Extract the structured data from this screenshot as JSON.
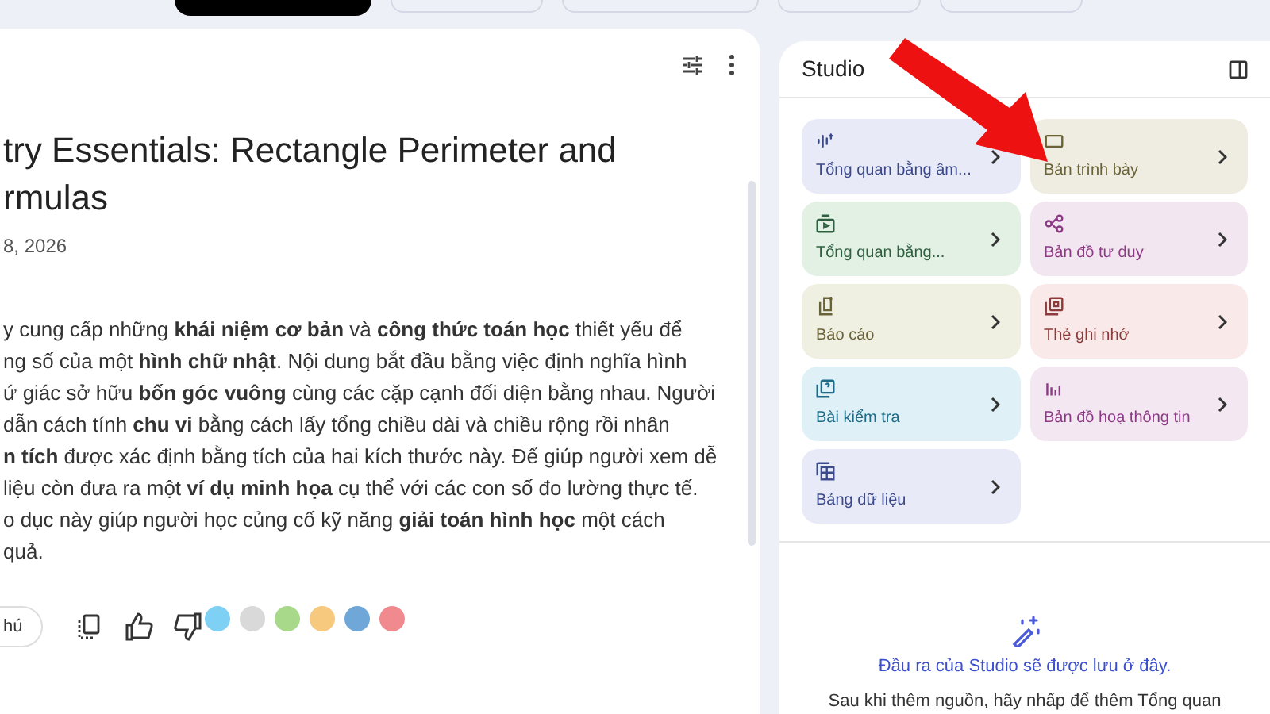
{
  "note": {
    "title_lines": [
      "try Essentials: Rectangle Perimeter and",
      "rmulas"
    ],
    "date": "8, 2026",
    "body_lines": [
      "y cung cấp những **khái niệm cơ bản** và **công thức toán học** thiết yếu để",
      "ng số của một **hình chữ nhật**. Nội dung bắt đầu bằng việc định nghĩa hình",
      "ứ giác sở hữu **bốn góc vuông** cùng các cặp cạnh đối diện bằng nhau. Người",
      "dẫn cách tính **chu vi** bằng cách lấy tổng chiều dài và chiều rộng rồi nhân",
      "**n tích** được xác định bằng tích của hai kích thước này. Để giúp người xem dễ",
      "liệu còn đưa ra một **ví dụ minh họa** cụ thể với các con số đo lường thực tế.",
      "o dục này giúp người học củng cố kỹ năng **giải toán hình học** một cách",
      "quả."
    ],
    "save_button": "hú",
    "color_dots": [
      {
        "color": "#7fd0f5"
      },
      {
        "color": "#d9d9d9"
      },
      {
        "color": "#a8d88a"
      },
      {
        "color": "#f7c97e"
      },
      {
        "color": "#6fa8d8"
      },
      {
        "color": "#f08a8e"
      }
    ]
  },
  "studio": {
    "title": "Studio",
    "cards": [
      {
        "label": "Tổng quan bằng âm...",
        "kind": "audio",
        "color": "#e8ebf7"
      },
      {
        "label": "Bản trình bày",
        "kind": "slides",
        "color": "#efede2"
      },
      {
        "label": "Tổng quan bằng...",
        "kind": "video",
        "color": "#e3f1e5"
      },
      {
        "label": "Bản đồ tư duy",
        "kind": "mindmap",
        "color": "#f2e7f0"
      },
      {
        "label": "Báo cáo",
        "kind": "report",
        "color": "#efefe2"
      },
      {
        "label": "Thẻ ghi nhớ",
        "kind": "flashcards",
        "color": "#f9e9e9"
      },
      {
        "label": "Bài kiểm tra",
        "kind": "quiz",
        "color": "#dff1f7"
      },
      {
        "label": "Bản đồ hoạ thông tin",
        "kind": "infographic",
        "color": "#f3e7f1"
      },
      {
        "label": "Bảng dữ liệu",
        "kind": "table",
        "color": "#e8ebf7"
      }
    ],
    "empty_title": "Đầu ra của Studio sẽ được lưu ở đây.",
    "empty_text": "Sau khi thêm nguồn, hãy nhấp để thêm Tổng quan"
  }
}
